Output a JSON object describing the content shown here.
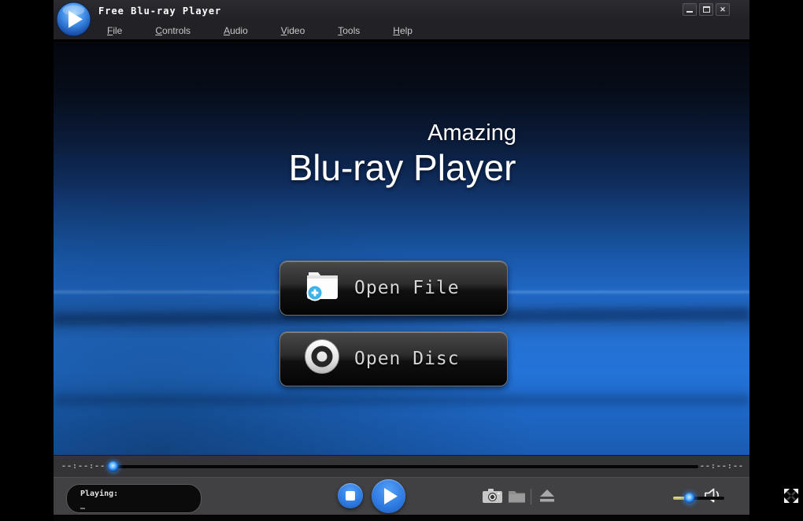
{
  "window": {
    "title": "Free Blu-ray Player",
    "controls": {
      "minimize": "minimize-icon",
      "maximize": "maximize-icon",
      "close": "✕"
    }
  },
  "menu": {
    "items": [
      "File",
      "Controls",
      "Audio",
      "Video",
      "Tools",
      "Help"
    ]
  },
  "hero": {
    "tagline": "Amazing",
    "title": "Blu-ray Player"
  },
  "actions": {
    "open_file_label": "Open File",
    "open_disc_label": "Open Disc"
  },
  "seekbar": {
    "elapsed": "--:--:--",
    "remaining": "--:--:--",
    "progress_percent": 0.5
  },
  "status": {
    "label": "Playing:",
    "value": "_"
  },
  "volume": {
    "percent": 32
  },
  "icons": [
    "play-logo-icon",
    "minimize-icon",
    "maximize-icon",
    "close-icon",
    "folder-add-icon",
    "disc-icon",
    "stop-icon",
    "play-icon",
    "snapshot-camera-icon",
    "folder-icon",
    "eject-icon",
    "speaker-icon",
    "fullscreen-icon",
    "seek-thumb",
    "volume-thumb"
  ],
  "colors": {
    "accent_blue": "#2f7ce4",
    "wallpaper_blue": "#2373d8",
    "volume_fill": "#cfc878",
    "control_bar_gray": "#414144",
    "seek_row_gray": "#343437",
    "title_bar_gray": "#26262b",
    "surround_black": "#000000"
  }
}
